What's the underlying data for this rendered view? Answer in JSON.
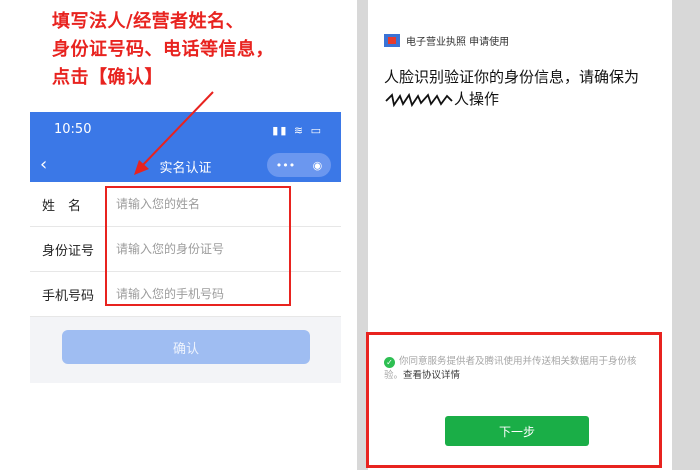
{
  "instruction": {
    "line1": "填写法人/经营者姓名、",
    "line2": "身份证号码、电话等信息，",
    "line3": "点击【确认】"
  },
  "left_phone": {
    "status_time": "10:50",
    "status_icons": "▮▮ ≋ ▭",
    "nav": {
      "back": "‹",
      "title": "实名认证",
      "more": "•••",
      "close": "◉"
    },
    "form": {
      "rows": [
        {
          "label": "姓　名",
          "placeholder": "请输入您的姓名"
        },
        {
          "label": "身份证号",
          "placeholder": "请输入您的身份证号"
        },
        {
          "label": "手机号码",
          "placeholder": "请输入您的手机号码"
        }
      ],
      "confirm_label": "确认"
    }
  },
  "right_phone": {
    "app_name": "电子营业执照 申请使用",
    "headline_part1": "人脸识别验证你的身份信息，请确保为",
    "headline_part2": "人操作",
    "consent_check": "✓",
    "consent_text": "你同意服务提供者及腾讯使用并传送相关数据用于身份核验。",
    "agreement_link": "查看协议详情",
    "next_label": "下一步"
  },
  "colors": {
    "accent_red": "#e8231f",
    "brand_blue": "#3b78e7",
    "confirm_disabled": "#9fbdf2",
    "wechat_green": "#1aae47"
  }
}
